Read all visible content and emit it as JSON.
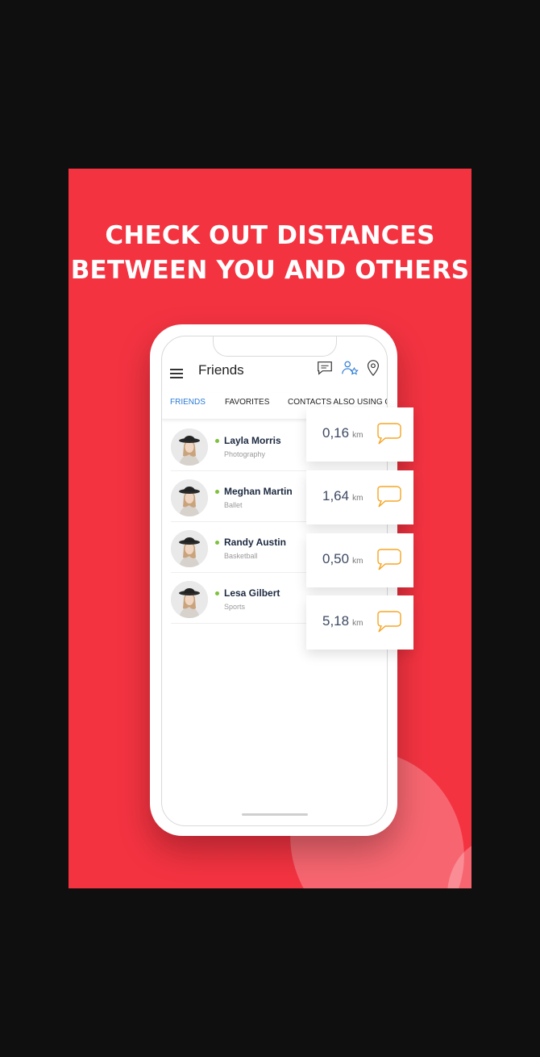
{
  "headline": [
    "CHECK OUT DISTANCES",
    "BETWEEN YOU AND OTHERS"
  ],
  "app": {
    "title": "Friends"
  },
  "tabs": [
    {
      "label": "FRIENDS",
      "active": true
    },
    {
      "label": "FAVORITES",
      "active": false
    },
    {
      "label": "CONTACTS ALSO USING CO",
      "active": false
    }
  ],
  "friends": [
    {
      "name": "Layla Morris",
      "activity": "Photography",
      "distance": "0,16",
      "unit": "km",
      "online": true
    },
    {
      "name": "Meghan Martin",
      "activity": "Ballet",
      "distance": "1,64",
      "unit": "km",
      "online": true
    },
    {
      "name": "Randy Austin",
      "activity": "Basketball",
      "distance": "0,50",
      "unit": "km",
      "online": true
    },
    {
      "name": "Lesa Gilbert",
      "activity": "Sports",
      "distance": "5,18",
      "unit": "km",
      "online": true
    }
  ],
  "icons": {
    "menu": "hamburger-menu-icon",
    "chat": "chat-bubble-icon",
    "favorites": "people-star-icon",
    "location": "location-pin-icon"
  },
  "colors": {
    "background": "#f43341",
    "accent": "#2b7bd6",
    "online": "#7ec13a",
    "chat_icon": "#f5a623"
  }
}
